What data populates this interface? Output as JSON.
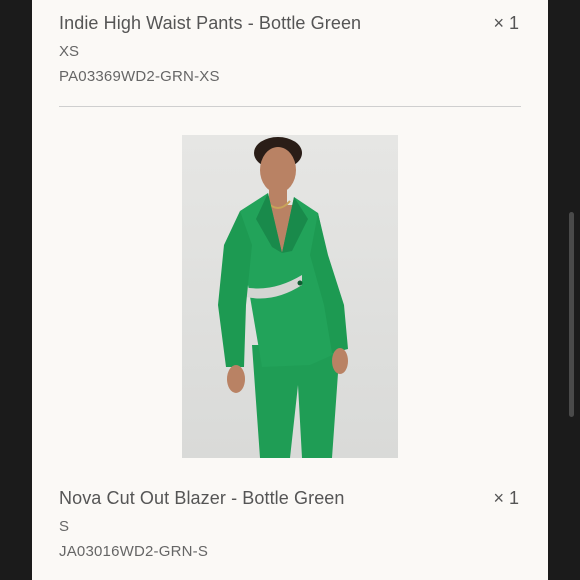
{
  "items": [
    {
      "title": "Indie High Waist Pants - Bottle Green",
      "quantity": "× 1",
      "variant": "XS",
      "sku": "PA03369WD2-GRN-XS"
    },
    {
      "title": "Nova Cut Out Blazer - Bottle Green",
      "quantity": "× 1",
      "variant": "S",
      "sku": "JA03016WD2-GRN-S"
    }
  ],
  "colors": {
    "background": "#1b1b1b",
    "panel": "#fbf9f6",
    "text": "#555555",
    "divider": "#cfcfcf",
    "garment_green": "#1f9d55"
  }
}
